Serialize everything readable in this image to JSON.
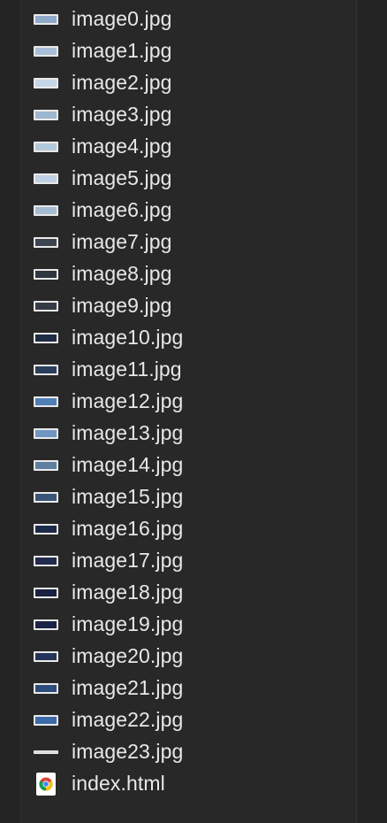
{
  "files": [
    {
      "name": "image0.jpg",
      "kind": "image",
      "thumb": "#8fa9c9"
    },
    {
      "name": "image1.jpg",
      "kind": "image",
      "thumb": "#a9bfd8"
    },
    {
      "name": "image2.jpg",
      "kind": "image",
      "thumb": "#c5d6e6"
    },
    {
      "name": "image3.jpg",
      "kind": "image",
      "thumb": "#9db7d0"
    },
    {
      "name": "image4.jpg",
      "kind": "image",
      "thumb": "#b4c8dc"
    },
    {
      "name": "image5.jpg",
      "kind": "image",
      "thumb": "#bfd0e2"
    },
    {
      "name": "image6.jpg",
      "kind": "image",
      "thumb": "#a6bcd2"
    },
    {
      "name": "image7.jpg",
      "kind": "image",
      "thumb": "#3c4450"
    },
    {
      "name": "image8.jpg",
      "kind": "image",
      "thumb": "#2f3640"
    },
    {
      "name": "image9.jpg",
      "kind": "image",
      "thumb": "#343b46"
    },
    {
      "name": "image10.jpg",
      "kind": "image",
      "thumb": "#1f2c45"
    },
    {
      "name": "image11.jpg",
      "kind": "image",
      "thumb": "#2a3f5e"
    },
    {
      "name": "image12.jpg",
      "kind": "image",
      "thumb": "#4f7fb4"
    },
    {
      "name": "image13.jpg",
      "kind": "image",
      "thumb": "#6f96c2"
    },
    {
      "name": "image14.jpg",
      "kind": "image",
      "thumb": "#5e7f9f"
    },
    {
      "name": "image15.jpg",
      "kind": "image",
      "thumb": "#3a5578"
    },
    {
      "name": "image16.jpg",
      "kind": "image",
      "thumb": "#1d2a4a"
    },
    {
      "name": "image17.jpg",
      "kind": "image",
      "thumb": "#222a4e"
    },
    {
      "name": "image18.jpg",
      "kind": "image",
      "thumb": "#1a2140"
    },
    {
      "name": "image19.jpg",
      "kind": "image",
      "thumb": "#1c2446"
    },
    {
      "name": "image20.jpg",
      "kind": "image",
      "thumb": "#23335a"
    },
    {
      "name": "image21.jpg",
      "kind": "image",
      "thumb": "#2c4c7c"
    },
    {
      "name": "image22.jpg",
      "kind": "image",
      "thumb": "#3d6aa8"
    },
    {
      "name": "image23.jpg",
      "kind": "image-thin",
      "thumb": "#d8dde3"
    },
    {
      "name": "index.html",
      "kind": "html",
      "icon": "chrome-icon"
    }
  ],
  "colors": {
    "background": "#242424",
    "pane": "#282828",
    "text": "#e8e8e8"
  }
}
